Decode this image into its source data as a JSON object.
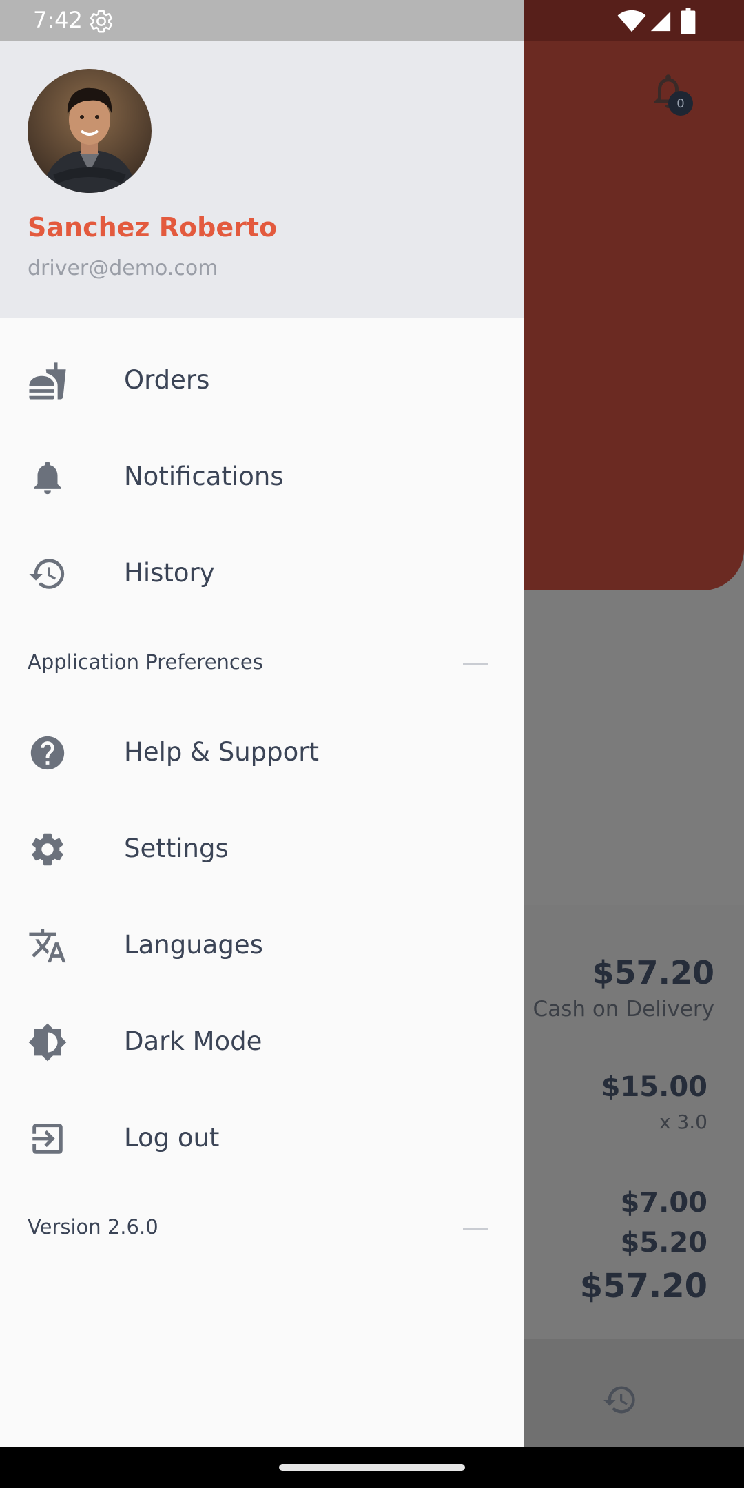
{
  "status_bar": {
    "time": "7:42"
  },
  "drawer": {
    "user": {
      "name": "Sanchez Roberto",
      "email": "driver@demo.com"
    },
    "items_primary": [
      {
        "label": "Orders",
        "icon": "orders-icon"
      },
      {
        "label": "Notifications",
        "icon": "bell-icon"
      },
      {
        "label": "History",
        "icon": "history-icon"
      }
    ],
    "section_title": "Application Preferences",
    "items_preferences": [
      {
        "label": "Help & Support",
        "icon": "help-icon"
      },
      {
        "label": "Settings",
        "icon": "gear-icon"
      },
      {
        "label": "Languages",
        "icon": "translate-icon"
      },
      {
        "label": "Dark Mode",
        "icon": "brightness-icon"
      },
      {
        "label": "Log out",
        "icon": "logout-icon"
      }
    ],
    "version": "Version 2.6.0"
  },
  "background": {
    "notification_count": "0",
    "order_total": "$57.20",
    "payment_method": "Cash on Delivery",
    "item_price": "$15.00",
    "item_quantity": "x 3.0",
    "amounts": [
      "$7.00",
      "$5.20",
      "$57.20"
    ]
  },
  "colors": {
    "accent": "#e35a3e",
    "header_bg": "#e8e9ed",
    "drawer_bg": "#fafafa",
    "text_primary": "#3b4456",
    "text_muted": "#9a9ea7",
    "app_header_dimmed": "#6b2a22"
  }
}
